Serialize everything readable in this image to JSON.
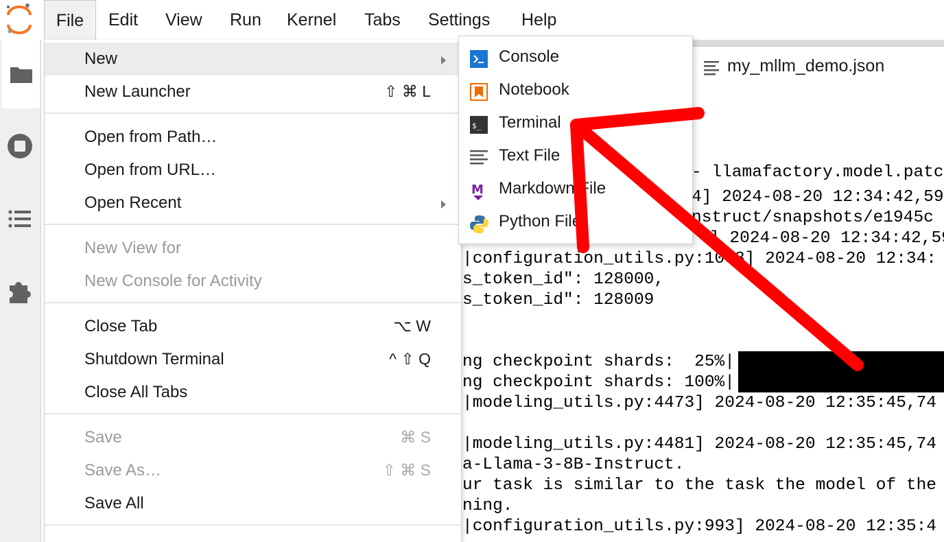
{
  "menubar": {
    "items": [
      "File",
      "Edit",
      "View",
      "Run",
      "Kernel",
      "Tabs",
      "Settings",
      "Help"
    ]
  },
  "tab": {
    "label": "my_mllm_demo.json"
  },
  "file_menu": {
    "new": "New",
    "new_launcher": "New Launcher",
    "new_launcher_shortcut": "⇧ ⌘ L",
    "open_from_path": "Open from Path…",
    "open_from_url": "Open from URL…",
    "open_recent": "Open Recent",
    "new_view_for": "New View for",
    "new_console_for_activity": "New Console for Activity",
    "close_tab": "Close Tab",
    "close_tab_shortcut": "⌥ W",
    "shutdown_terminal": "Shutdown Terminal",
    "shutdown_terminal_shortcut": "^ ⇧ Q",
    "close_all_tabs": "Close All Tabs",
    "save": "Save",
    "save_shortcut": "⌘ S",
    "save_as": "Save As…",
    "save_as_shortcut": "⇧ ⌘ S",
    "save_all": "Save All"
  },
  "new_submenu": {
    "console": "Console",
    "notebook": "Notebook",
    "terminal": "Terminal",
    "text_file": "Text File",
    "markdown_file": "Markdown File",
    "python_file": "Python File"
  },
  "terminal": {
    "lines": [
      "- llamafactory.model.patc",
      "4] 2024-08-20 12:34:42,59",
      "nstruct/snapshots/e1945c",
      "] 2024-08-20 12:34:42,59",
      "|configuration_utils.py:1008] 2024-08-20 12:34:",
      "s_token_id\": 128000,",
      "s_token_id\": 128009",
      "ng checkpoint shards:  25%|",
      "ng checkpoint shards: 100%|",
      "|modeling_utils.py:4473] 2024-08-20 12:35:45,74",
      "|modeling_utils.py:4481] 2024-08-20 12:35:45,74",
      "a-Llama-3-8B-Instruct.",
      "ur task is similar to the task the model of the",
      "ning.",
      "|configuration_utils.py:993] 2024-08-20 12:35:4"
    ]
  },
  "colors": {
    "annotation_arrow": "#ff0000",
    "jupyter_orange": "#f37726",
    "console_blue": "#1976d2",
    "markdown_purple": "#7b1fa2"
  }
}
